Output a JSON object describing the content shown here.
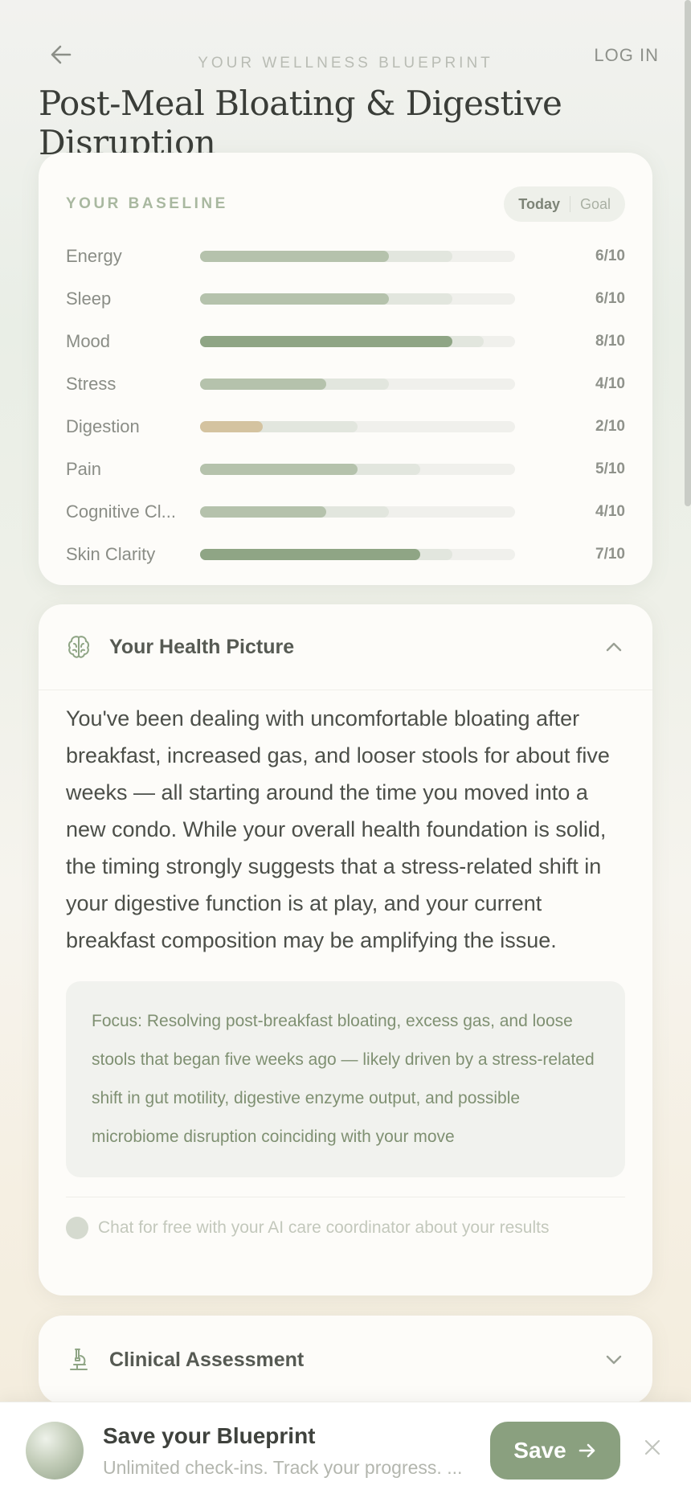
{
  "header": {
    "eyebrow": "YOUR WELLNESS BLUEPRINT",
    "login_label": "LOG IN",
    "title": "Post-Meal Bloating & Digestive Disruption"
  },
  "baseline": {
    "label": "YOUR BASELINE",
    "toggle_today": "Today",
    "toggle_goal": "Goal",
    "metrics": [
      {
        "name": "Energy",
        "value": "6/10",
        "current": 6,
        "goal": 8,
        "color": "#b5c2ac"
      },
      {
        "name": "Sleep",
        "value": "6/10",
        "current": 6,
        "goal": 8,
        "color": "#b5c2ac"
      },
      {
        "name": "Mood",
        "value": "8/10",
        "current": 8,
        "goal": 9,
        "color": "#8fa585"
      },
      {
        "name": "Stress",
        "value": "4/10",
        "current": 4,
        "goal": 6,
        "color": "#b5c2ac"
      },
      {
        "name": "Digestion",
        "value": "2/10",
        "current": 2,
        "goal": 5,
        "color": "#d4c3a0"
      },
      {
        "name": "Pain",
        "value": "5/10",
        "current": 5,
        "goal": 7,
        "color": "#b5c2ac"
      },
      {
        "name": "Cognitive Cl...",
        "value": "4/10",
        "current": 4,
        "goal": 6,
        "color": "#b5c2ac"
      },
      {
        "name": "Skin Clarity",
        "value": "7/10",
        "current": 7,
        "goal": 8,
        "color": "#8fa585"
      }
    ]
  },
  "health_picture": {
    "title": "Your Health Picture",
    "summary": "You've been dealing with uncomfortable bloating after breakfast, increased gas, and looser stools for about five weeks — all starting around the time you moved into a new condo. While your overall health foundation is solid, the timing strongly suggests that a stress-related shift in your digestive function is at play, and your current breakfast composition may be amplifying the issue.",
    "focus": "Focus: Resolving post-breakfast bloating, excess gas, and loose stools that began five weeks ago — likely driven by a stress-related shift in gut motility, digestive enzyme output, and possible microbiome disruption coinciding with your move",
    "chat_prompt": "Chat for free with your AI care coordinator about your results"
  },
  "clinical": {
    "title": "Clinical Assessment"
  },
  "save_bar": {
    "title": "Save your Blueprint",
    "subtitle": "Unlimited check-ins. Track your progress. ...",
    "button_label": "Save"
  },
  "icons": {
    "back": "arrow-left-icon",
    "brain": "brain-icon",
    "microscope": "microscope-icon",
    "chevron_up": "chevron-up-icon",
    "chevron_down": "chevron-down-icon",
    "arrow_right": "arrow-right-icon",
    "close": "close-icon"
  }
}
